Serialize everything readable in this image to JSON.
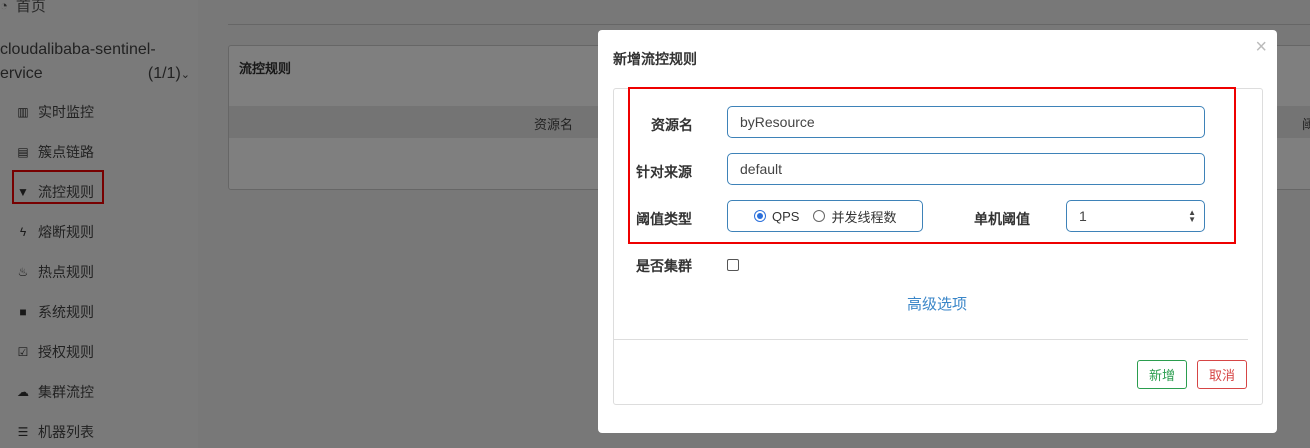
{
  "sidebar": {
    "home_label": "首页",
    "app_name_line1": "cloudalibaba-sentinel-",
    "app_name_line2": "ervice",
    "app_count": "(1/1)",
    "items": [
      {
        "label": "实时监控",
        "icon": "bar-chart-icon"
      },
      {
        "label": "簇点链路",
        "icon": "list-icon"
      },
      {
        "label": "流控规则",
        "icon": "filter-icon"
      },
      {
        "label": "熔断规则",
        "icon": "flash-icon"
      },
      {
        "label": "热点规则",
        "icon": "fire-icon"
      },
      {
        "label": "系统规则",
        "icon": "lock-icon"
      },
      {
        "label": "授权规则",
        "icon": "check-square-icon"
      },
      {
        "label": "集群流控",
        "icon": "cloud-icon"
      },
      {
        "label": "机器列表",
        "icon": "th-list-icon"
      }
    ]
  },
  "panel": {
    "title": "流控规则",
    "col_resource": "资源名",
    "col_partial": "阈"
  },
  "modal": {
    "title": "新增流控规则",
    "close_glyph": "×",
    "resource_label": "资源名",
    "resource_value": "byResource",
    "source_label": "针对来源",
    "source_value": "default",
    "threshold_type_label": "阈值类型",
    "threshold_type_options": [
      {
        "label": "QPS",
        "selected": true
      },
      {
        "label": "并发线程数",
        "selected": false
      }
    ],
    "single_threshold_label": "单机阈值",
    "single_threshold_value": "1",
    "cluster_label": "是否集群",
    "cluster_checked": false,
    "advanced_link": "高级选项",
    "add_button": "新增",
    "cancel_button": "取消"
  },
  "colors": {
    "highlight_red": "#ee0000",
    "input_border": "#3e82b8",
    "link_blue": "#3a86c8",
    "add_green": "#2a9d4e",
    "cancel_red": "#d64545"
  }
}
